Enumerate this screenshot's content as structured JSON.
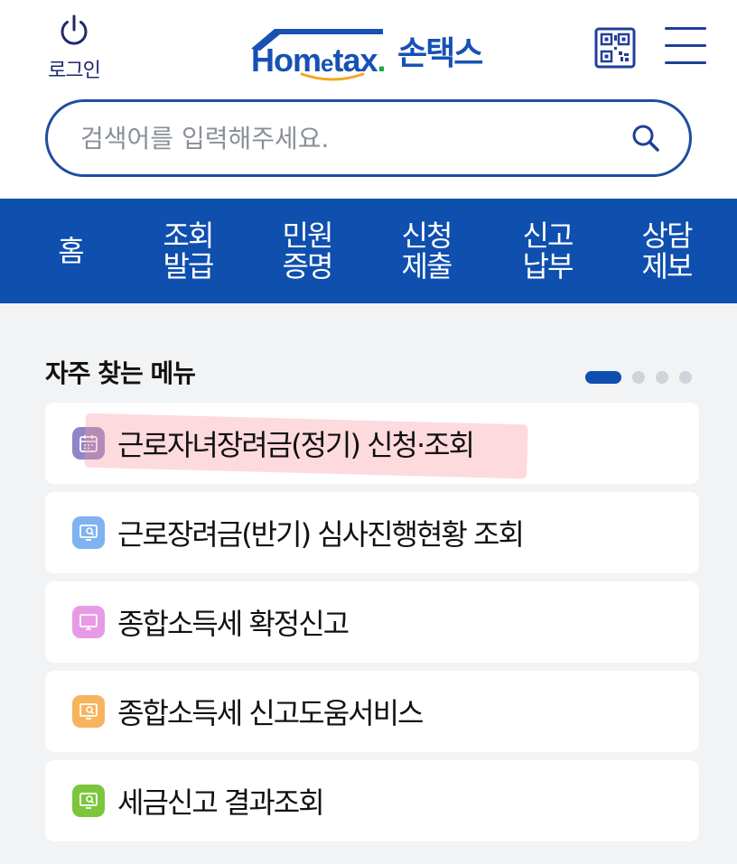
{
  "header": {
    "login_label": "로그인",
    "logo": {
      "word_main": "Hom",
      "word_e": "e",
      "word_tail": "tax",
      "word_dot": ".",
      "brand": "손택스"
    }
  },
  "search": {
    "placeholder": "검색어를 입력해주세요."
  },
  "nav": {
    "tabs": [
      {
        "lines": [
          "홈"
        ],
        "active": true
      },
      {
        "lines": [
          "조회",
          "발급"
        ],
        "active": false
      },
      {
        "lines": [
          "민원",
          "증명"
        ],
        "active": false
      },
      {
        "lines": [
          "신청",
          "제출"
        ],
        "active": false
      },
      {
        "lines": [
          "신고",
          "납부"
        ],
        "active": false
      },
      {
        "lines": [
          "상담",
          "제보"
        ],
        "active": false
      }
    ]
  },
  "main": {
    "section_title": "자주 찾는 메뉴",
    "pager": {
      "total": 4,
      "current": 1
    },
    "menu_items": [
      {
        "label": "근로자녀장려금(정기) 신청·조회",
        "icon": "calendar-icon",
        "color": "#8e86c6",
        "highlighted": true
      },
      {
        "label": "근로장려금(반기) 심사진행현황 조회",
        "icon": "monitor-search-icon",
        "color": "#7fb2f0",
        "highlighted": false
      },
      {
        "label": "종합소득세 확정신고",
        "icon": "monitor-icon",
        "color": "#e79be6",
        "highlighted": false
      },
      {
        "label": "종합소득세 신고도움서비스",
        "icon": "monitor-search-icon",
        "color": "#f7b45c",
        "highlighted": false
      },
      {
        "label": "세금신고 결과조회",
        "icon": "monitor-search-icon",
        "color": "#7cc63b",
        "highlighted": false
      }
    ]
  },
  "colors": {
    "brand_blue": "#0f4fae",
    "accent_orange": "#f5a623",
    "logo_green": "#1fa54a"
  }
}
